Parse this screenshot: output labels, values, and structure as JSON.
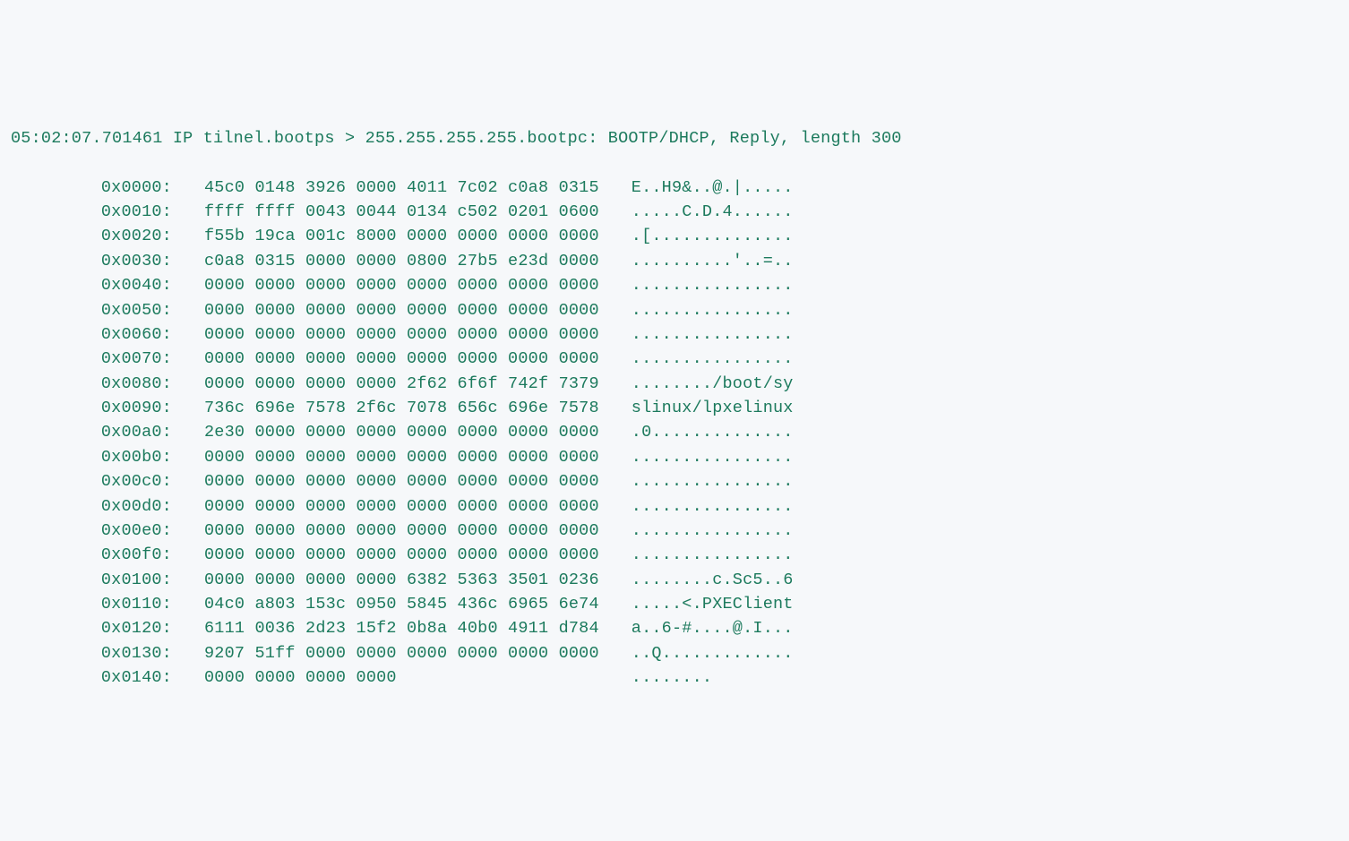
{
  "header": "05:02:07.701461 IP tilnel.bootps > 255.255.255.255.bootpc: BOOTP/DHCP, Reply, length 300",
  "rows": [
    {
      "offset": "0x0000:",
      "hex": "45c0 0148 3926 0000 4011 7c02 c0a8 0315",
      "ascii": "E..H9&..@.|....."
    },
    {
      "offset": "0x0010:",
      "hex": "ffff ffff 0043 0044 0134 c502 0201 0600",
      "ascii": ".....C.D.4......"
    },
    {
      "offset": "0x0020:",
      "hex": "f55b 19ca 001c 8000 0000 0000 0000 0000",
      "ascii": ".[.............."
    },
    {
      "offset": "0x0030:",
      "hex": "c0a8 0315 0000 0000 0800 27b5 e23d 0000",
      "ascii": "..........'..=.."
    },
    {
      "offset": "0x0040:",
      "hex": "0000 0000 0000 0000 0000 0000 0000 0000",
      "ascii": "................"
    },
    {
      "offset": "0x0050:",
      "hex": "0000 0000 0000 0000 0000 0000 0000 0000",
      "ascii": "................"
    },
    {
      "offset": "0x0060:",
      "hex": "0000 0000 0000 0000 0000 0000 0000 0000",
      "ascii": "................"
    },
    {
      "offset": "0x0070:",
      "hex": "0000 0000 0000 0000 0000 0000 0000 0000",
      "ascii": "................"
    },
    {
      "offset": "0x0080:",
      "hex": "0000 0000 0000 0000 2f62 6f6f 742f 7379",
      "ascii": "......../boot/sy"
    },
    {
      "offset": "0x0090:",
      "hex": "736c 696e 7578 2f6c 7078 656c 696e 7578",
      "ascii": "slinux/lpxelinux"
    },
    {
      "offset": "0x00a0:",
      "hex": "2e30 0000 0000 0000 0000 0000 0000 0000",
      "ascii": ".0.............."
    },
    {
      "offset": "0x00b0:",
      "hex": "0000 0000 0000 0000 0000 0000 0000 0000",
      "ascii": "................"
    },
    {
      "offset": "0x00c0:",
      "hex": "0000 0000 0000 0000 0000 0000 0000 0000",
      "ascii": "................"
    },
    {
      "offset": "0x00d0:",
      "hex": "0000 0000 0000 0000 0000 0000 0000 0000",
      "ascii": "................"
    },
    {
      "offset": "0x00e0:",
      "hex": "0000 0000 0000 0000 0000 0000 0000 0000",
      "ascii": "................"
    },
    {
      "offset": "0x00f0:",
      "hex": "0000 0000 0000 0000 0000 0000 0000 0000",
      "ascii": "................"
    },
    {
      "offset": "0x0100:",
      "hex": "0000 0000 0000 0000 6382 5363 3501 0236",
      "ascii": "........c.Sc5..6"
    },
    {
      "offset": "0x0110:",
      "hex": "04c0 a803 153c 0950 5845 436c 6965 6e74",
      "ascii": ".....<.PXEClient"
    },
    {
      "offset": "0x0120:",
      "hex": "6111 0036 2d23 15f2 0b8a 40b0 4911 d784",
      "ascii": "a..6-#....@.I..."
    },
    {
      "offset": "0x0130:",
      "hex": "9207 51ff 0000 0000 0000 0000 0000 0000",
      "ascii": "..Q............."
    },
    {
      "offset": "0x0140:",
      "hex": "0000 0000 0000 0000                    ",
      "ascii": "........"
    }
  ]
}
